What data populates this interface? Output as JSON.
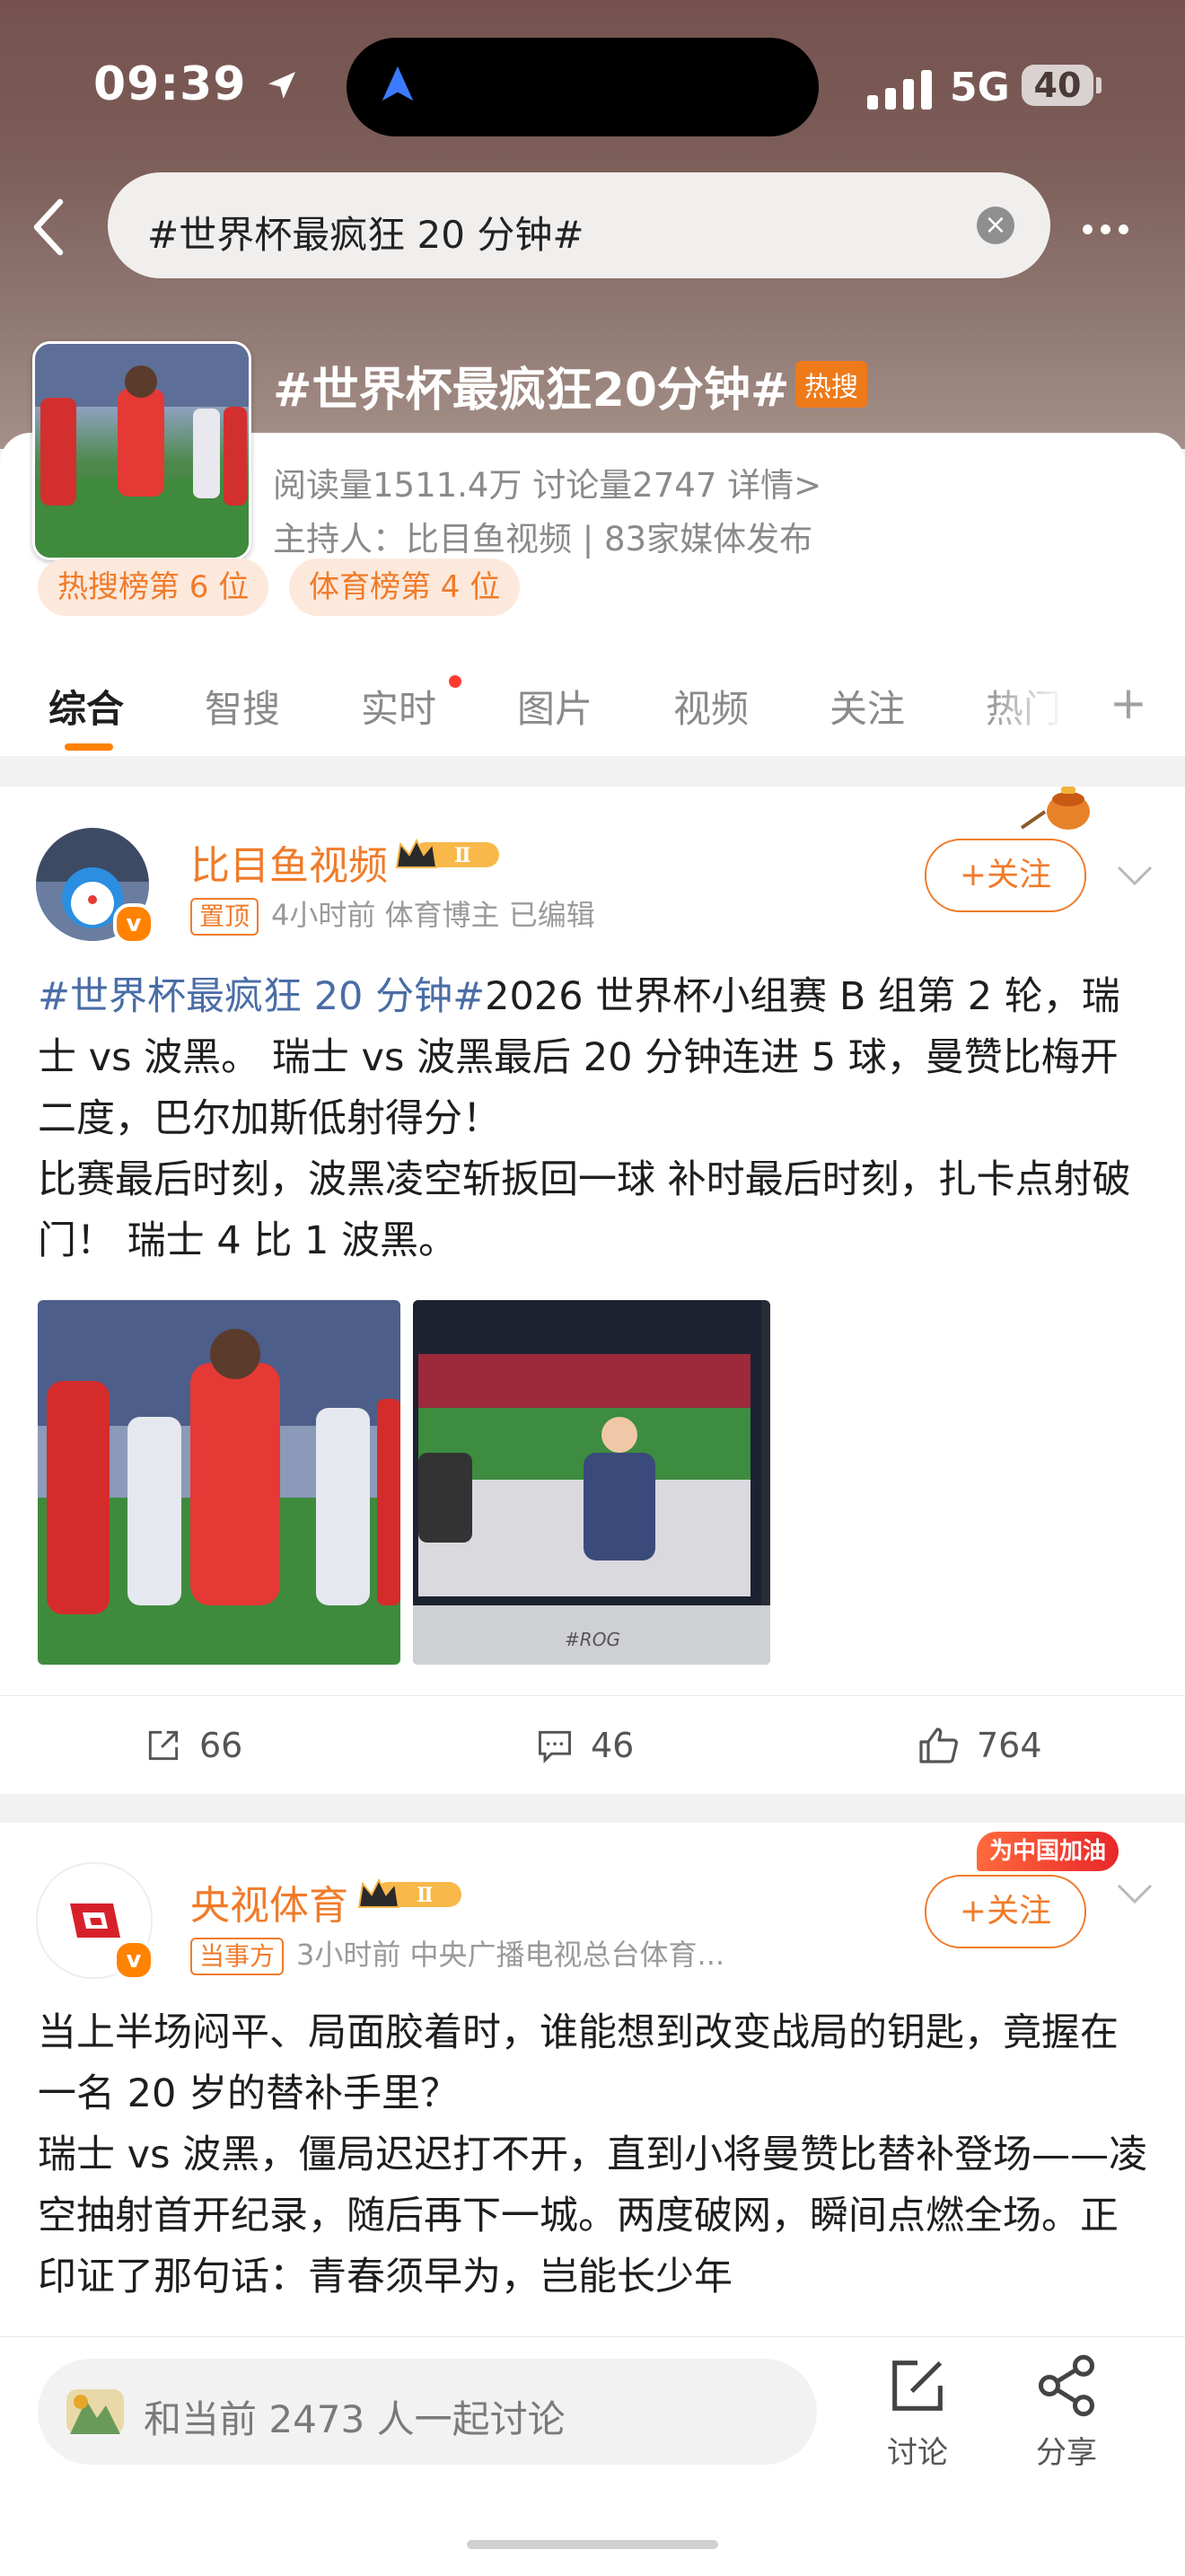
{
  "status": {
    "time": "09:39",
    "network": "5G",
    "battery": "40"
  },
  "search": {
    "query": "#世界杯最疯狂 20 分钟#"
  },
  "topic": {
    "title": "#世界杯最疯狂20分钟#",
    "hot_badge": "热搜",
    "stats": "阅读量1511.4万   讨论量2747   详情>",
    "host": "主持人：比目鱼视频 | 83家媒体发布",
    "rank_hot": "热搜榜第 6 位",
    "rank_sports": "体育榜第 4 位"
  },
  "tabs": [
    "综合",
    "智搜",
    "实时",
    "图片",
    "视频",
    "关注",
    "热门"
  ],
  "posts": [
    {
      "author": "比目鱼视频",
      "level": "Ⅱ",
      "tag": "置顶",
      "meta": "4小时前   体育博主   已编辑",
      "follow": "+关注",
      "hashtag": "#世界杯最疯狂 20 分钟#",
      "text1": "2026 世界杯小组赛 B 组第 2 轮，瑞士 vs 波黑。  瑞士 vs 波黑最后 20 分钟连进 5 球，曼赞比梅开二度，巴尔加斯低射得分！",
      "text2": "比赛最后时刻，波黑凌空斩扳回一球 补时最后时刻，扎卡点射破门！  瑞士 4 比 1 波黑。",
      "repost_count": "66",
      "comment_count": "46",
      "like_count": "764"
    },
    {
      "author": "央视体育",
      "level": "Ⅱ",
      "tag": "当事方",
      "meta": "3小时前   中央广播电视总台体育...",
      "follow": "+关注",
      "badge": "为中国加油",
      "text1": "当上半场闷平、局面胶着时，谁能想到改变战局的钥匙，竟握在一名 20 岁的替补手里？",
      "text2": "瑞士 vs 波黑，僵局迟迟打不开，直到小将曼赞比替补登场——凌空抽射首开纪录，随后再下一城。两度破网，瞬间点燃全场。正印证了那句话：青春须早为，岂能长少年"
    }
  ],
  "bottom": {
    "discuss_placeholder": "和当前 2473 人一起讨论",
    "discuss_label": "讨论",
    "share_label": "分享"
  }
}
